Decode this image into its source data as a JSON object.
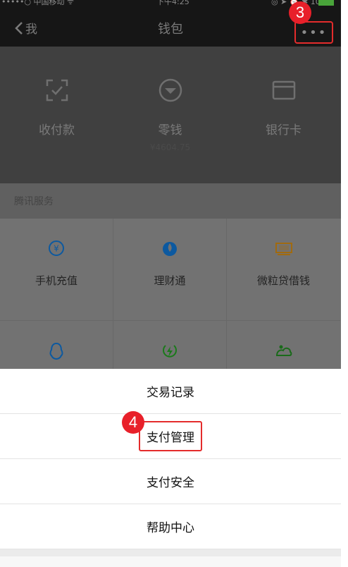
{
  "status_bar": {
    "carrier": "•••••○ 中国移动 ᯤ",
    "time": "下午4:25",
    "indicators": "◎ ➤ ⏰ ✱ 100%",
    "battery_color": "#49a43a"
  },
  "nav": {
    "back_label": "我",
    "title": "钱包",
    "more_label": "•••"
  },
  "callouts": {
    "step_3": "3",
    "step_4": "4",
    "highlight_color": "#e42c2c"
  },
  "wallet": {
    "items": [
      {
        "label": "收付款",
        "icon": "scan-icon"
      },
      {
        "label": "零钱",
        "sub": "¥4604.75",
        "icon": "change-icon"
      },
      {
        "label": "银行卡",
        "icon": "bank-card-icon"
      }
    ]
  },
  "tencent_services": {
    "title": "腾讯服务",
    "items": [
      {
        "label": "手机充值",
        "icon": "phone-recharge-icon",
        "color": "#0c59a0"
      },
      {
        "label": "理财通",
        "icon": "wealth-icon",
        "color": "#0c59a0"
      },
      {
        "label": "微粒贷借钱",
        "icon": "loan-icon",
        "color": "#a06a10"
      },
      {
        "label": "",
        "icon": "qq-icon",
        "color": "#0c59a0"
      },
      {
        "label": "",
        "icon": "lightning-icon",
        "color": "#1a7a1a"
      },
      {
        "label": "",
        "icon": "landscape-icon",
        "color": "#1a6a1a"
      }
    ]
  },
  "action_sheet": {
    "items": [
      "交易记录",
      "支付管理",
      "支付安全",
      "帮助中心"
    ],
    "highlighted_index": 1
  }
}
